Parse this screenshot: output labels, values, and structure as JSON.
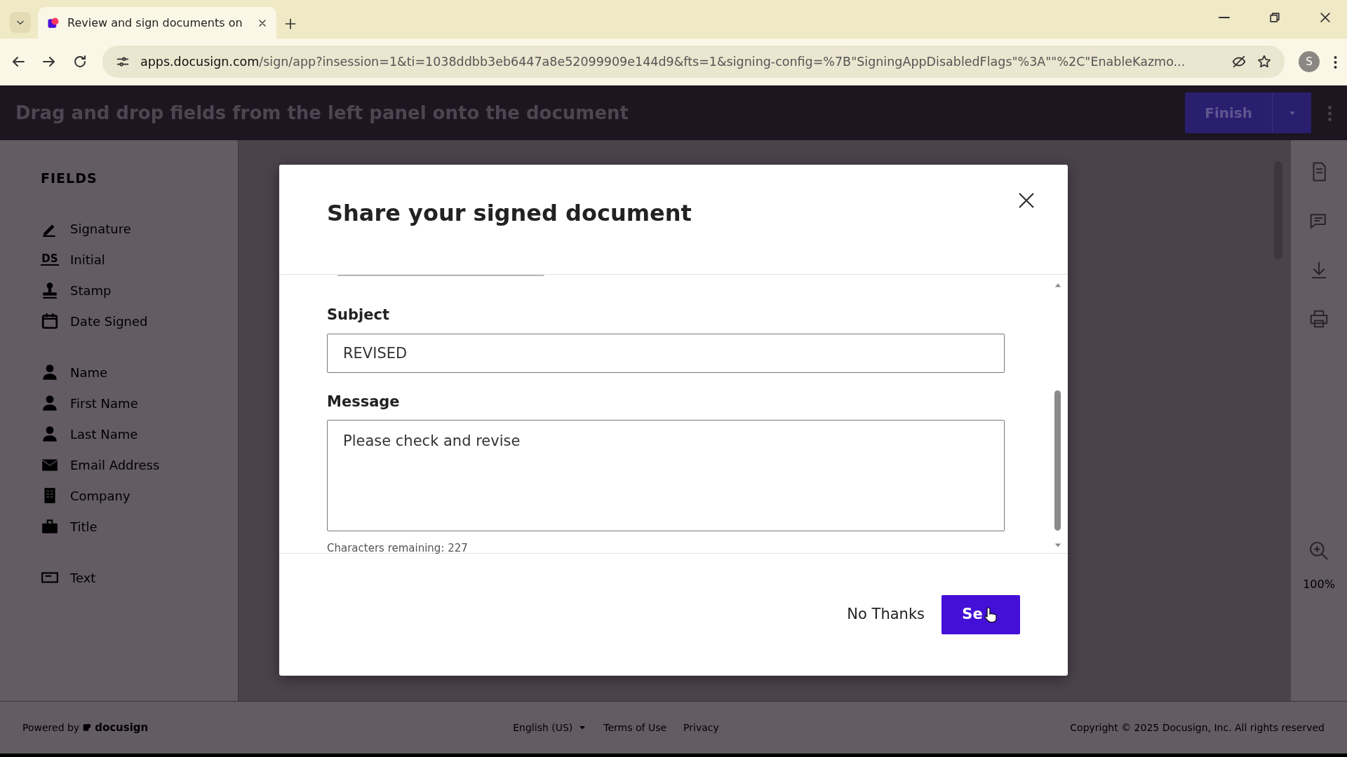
{
  "browser": {
    "tab_title": "Review and sign documents on",
    "url": "apps.docusign.com/sign/app?insession=1&ti=1038ddbb3eb6447a8e52099909e144d9&fts=1&signing-config=%7B\"SigningAppDisabledFlags\"%3A\"\"%2C\"EnableKazmo...",
    "profile_initial": "S"
  },
  "app_header": {
    "instruction": "Drag and drop fields from the left panel onto the document",
    "finish_button": "Finish"
  },
  "fields_panel": {
    "title": "FIELDS",
    "groups": [
      {
        "items": [
          {
            "kind": "signature",
            "label": "Signature"
          },
          {
            "kind": "initial",
            "icon_text": "DS",
            "label": "Initial"
          },
          {
            "kind": "stamp",
            "label": "Stamp"
          },
          {
            "kind": "calendar",
            "label": "Date Signed"
          }
        ]
      },
      {
        "items": [
          {
            "kind": "person",
            "label": "Name"
          },
          {
            "kind": "person",
            "label": "First Name"
          },
          {
            "kind": "person",
            "label": "Last Name"
          },
          {
            "kind": "envelope",
            "label": "Email Address"
          },
          {
            "kind": "building",
            "label": "Company"
          },
          {
            "kind": "briefcase",
            "label": "Title"
          }
        ]
      },
      {
        "items": [
          {
            "kind": "textbox",
            "label": "Text"
          }
        ]
      }
    ]
  },
  "right_toolbar": {
    "zoom_level": "100%"
  },
  "dialog": {
    "title": "Share your signed document",
    "subject_label": "Subject",
    "subject_value": "REVISED",
    "message_label": "Message",
    "message_value": "Please check and revise",
    "char_count": "Characters remaining: 227",
    "secondary_button": "No Thanks",
    "primary_button": "Se"
  },
  "footer": {
    "powered_by": "Powered by",
    "brand": "docusign",
    "language": "English (US)",
    "links": [
      "Terms of Use",
      "Privacy"
    ],
    "copyright": "Copyright © 2025 Docusign, Inc. All rights reserved"
  }
}
